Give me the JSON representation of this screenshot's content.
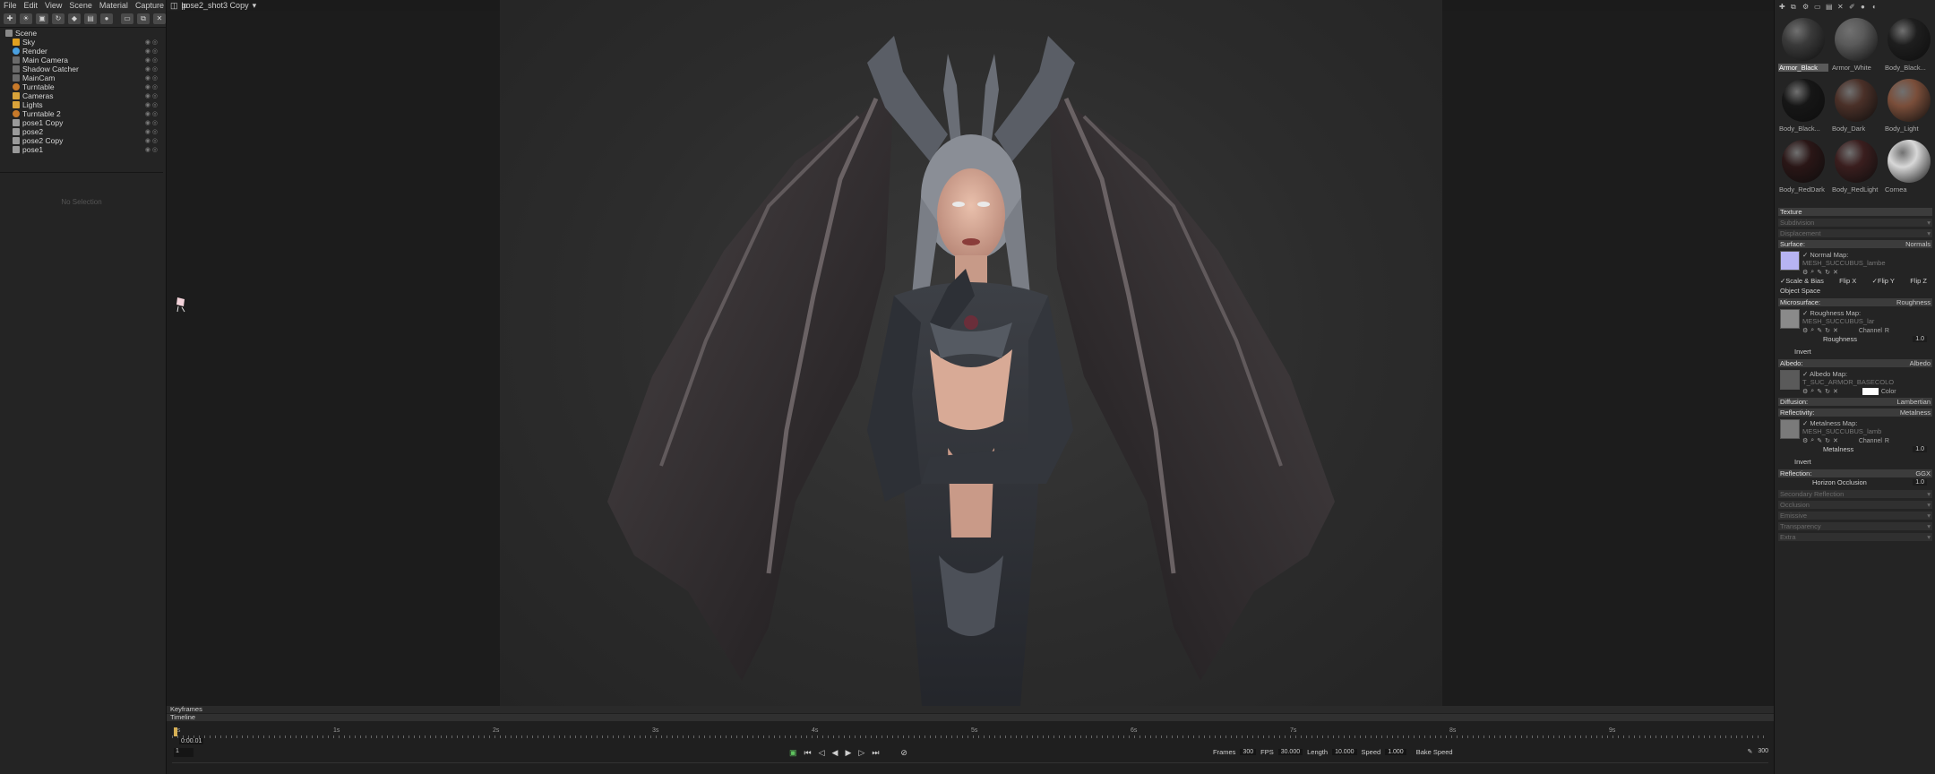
{
  "menu": [
    "File",
    "Edit",
    "View",
    "Scene",
    "Material",
    "Capture",
    "Help"
  ],
  "document": {
    "title": "pose2_shot3 Copy"
  },
  "outliner": {
    "items": [
      {
        "label": "Scene",
        "color": "#8a8a8a"
      },
      {
        "label": "Sky",
        "color": "#e0a020"
      },
      {
        "label": "Render",
        "color": "#4aa0e0"
      },
      {
        "label": "Main Camera",
        "color": "#6a6a6a"
      },
      {
        "label": "Shadow Catcher",
        "color": "#6a6a6a"
      },
      {
        "label": "MainCam",
        "color": "#6a6a6a"
      },
      {
        "label": "Turntable",
        "color": "#c87a2a"
      },
      {
        "label": "Cameras",
        "color": "#d9a33a"
      },
      {
        "label": "Lights",
        "color": "#d9a33a"
      },
      {
        "label": "Turntable 2",
        "color": "#c87a2a"
      },
      {
        "label": "pose1 Copy",
        "color": "#9a9a9a"
      },
      {
        "label": "pose2",
        "color": "#9a9a9a"
      },
      {
        "label": "pose2 Copy",
        "color": "#9a9a9a"
      },
      {
        "label": "pose1",
        "color": "#9a9a9a"
      }
    ]
  },
  "selection": {
    "empty_text": "No Selection"
  },
  "materials": [
    {
      "name": "Armor_Black",
      "color": "#3a3a3a",
      "selected": true
    },
    {
      "name": "Armor_White",
      "color": "#5a5a5a",
      "selected": false
    },
    {
      "name": "Body_Black...",
      "color": "#1e1e1e",
      "selected": false
    },
    {
      "name": "Body_Black...",
      "color": "#161616",
      "selected": false
    },
    {
      "name": "Body_Dark",
      "color": "#4a3028",
      "selected": false
    },
    {
      "name": "Body_Light",
      "color": "#7a4e3a",
      "selected": false
    },
    {
      "name": "Body_RedDark",
      "color": "#2a1616",
      "selected": false
    },
    {
      "name": "Body_RedLight",
      "color": "#3a1e1e",
      "selected": false
    },
    {
      "name": "Cornea",
      "color": "#d8d8d8",
      "selected": false
    }
  ],
  "properties": {
    "texture": "Texture",
    "subdivision": "Subdivision",
    "displacement": "Displacement",
    "surface": {
      "label": "Surface:",
      "value": "Normals"
    },
    "normal_map": {
      "label": "Normal Map:",
      "file": "MESH_SUCCUBUS_lambe"
    },
    "normal_opts": [
      "Scale & Bias",
      "Flip X",
      "Flip Y",
      "Flip Z"
    ],
    "object_space": "Object Space",
    "microsurface": {
      "label": "Microsurface:",
      "value": "Roughness"
    },
    "roughness_map": {
      "label": "Roughness Map:",
      "file": "MESH_SUCCUBUS_lar",
      "channel": "Channel",
      "channel_value": "R"
    },
    "roughness": {
      "label": "Roughness",
      "value": "1.0"
    },
    "invert": "Invert",
    "albedo": {
      "label": "Albedo:",
      "value": "Albedo"
    },
    "albedo_map": {
      "label": "Albedo Map:",
      "file": "T_SUC_ARMOR_BASECOLO",
      "color_label": "Color"
    },
    "diffusion": {
      "label": "Diffusion:",
      "value": "Lambertian"
    },
    "reflectivity": {
      "label": "Reflectivity:",
      "value": "Metalness"
    },
    "metalness_map": {
      "label": "Metalness Map:",
      "file": "MESH_SUCCUBUS_lamb",
      "channel": "Channel",
      "channel_value": "R"
    },
    "metalness": {
      "label": "Metalness",
      "value": "1.0"
    },
    "invert2": "Invert",
    "reflection": {
      "label": "Reflection:",
      "value": "GGX"
    },
    "horizon": {
      "label": "Horizon Occlusion",
      "value": "1.0"
    },
    "collapsed": [
      "Secondary Reflection",
      "Occlusion",
      "Emissive",
      "Transparency",
      "Extra"
    ]
  },
  "timeline": {
    "keyframes_label": "Keyframes",
    "timeline_label": "Timeline",
    "tick_labels": [
      "0s",
      "1s",
      "2s",
      "3s",
      "4s",
      "5s",
      "6s",
      "7s",
      "8s",
      "9s"
    ],
    "current_time": "0:00.01",
    "start_frame": "1",
    "frames_label": "Frames",
    "frames": "300",
    "fps_label": "FPS",
    "fps": "30.000",
    "length_label": "Length",
    "length": "10.000",
    "speed_label": "Speed",
    "speed": "1.000",
    "bake_speed": "Bake Speed",
    "end_frame": "300"
  }
}
